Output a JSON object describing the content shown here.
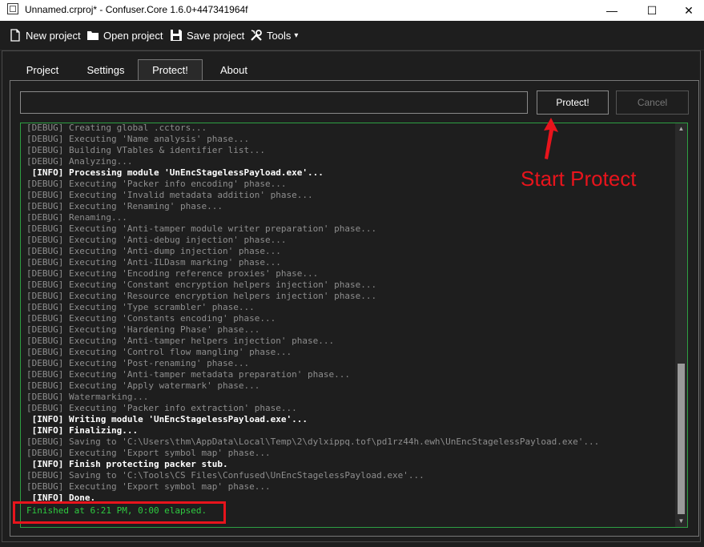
{
  "window": {
    "title": "Unnamed.crproj* - Confuser.Core 1.6.0+447341964f",
    "minimize": "—",
    "maximize": "☐",
    "close": "✕"
  },
  "toolbar": {
    "new_project": "New project",
    "open_project": "Open project",
    "save_project": "Save project",
    "tools": "Tools",
    "tools_caret": "▾"
  },
  "tabs": [
    "Project",
    "Settings",
    "Protect!",
    "About"
  ],
  "active_tab": "Protect!",
  "protect": {
    "path_value": "",
    "protect_label": "Protect!",
    "cancel_label": "Cancel"
  },
  "log": [
    {
      "level": "debug",
      "text": "[DEBUG] Creating global .cctors..."
    },
    {
      "level": "debug",
      "text": "[DEBUG] Executing 'Name analysis' phase..."
    },
    {
      "level": "debug",
      "text": "[DEBUG] Building VTables & identifier list..."
    },
    {
      "level": "debug",
      "text": "[DEBUG] Analyzing..."
    },
    {
      "level": "info",
      "text": " [INFO] Processing module 'UnEncStagelessPayload.exe'..."
    },
    {
      "level": "debug",
      "text": "[DEBUG] Executing 'Packer info encoding' phase..."
    },
    {
      "level": "debug",
      "text": "[DEBUG] Executing 'Invalid metadata addition' phase..."
    },
    {
      "level": "debug",
      "text": "[DEBUG] Executing 'Renaming' phase..."
    },
    {
      "level": "debug",
      "text": "[DEBUG] Renaming..."
    },
    {
      "level": "debug",
      "text": "[DEBUG] Executing 'Anti-tamper module writer preparation' phase..."
    },
    {
      "level": "debug",
      "text": "[DEBUG] Executing 'Anti-debug injection' phase..."
    },
    {
      "level": "debug",
      "text": "[DEBUG] Executing 'Anti-dump injection' phase..."
    },
    {
      "level": "debug",
      "text": "[DEBUG] Executing 'Anti-ILDasm marking' phase..."
    },
    {
      "level": "debug",
      "text": "[DEBUG] Executing 'Encoding reference proxies' phase..."
    },
    {
      "level": "debug",
      "text": "[DEBUG] Executing 'Constant encryption helpers injection' phase..."
    },
    {
      "level": "debug",
      "text": "[DEBUG] Executing 'Resource encryption helpers injection' phase..."
    },
    {
      "level": "debug",
      "text": "[DEBUG] Executing 'Type scrambler' phase..."
    },
    {
      "level": "debug",
      "text": "[DEBUG] Executing 'Constants encoding' phase..."
    },
    {
      "level": "debug",
      "text": "[DEBUG] Executing 'Hardening Phase' phase..."
    },
    {
      "level": "debug",
      "text": "[DEBUG] Executing 'Anti-tamper helpers injection' phase..."
    },
    {
      "level": "debug",
      "text": "[DEBUG] Executing 'Control flow mangling' phase..."
    },
    {
      "level": "debug",
      "text": "[DEBUG] Executing 'Post-renaming' phase..."
    },
    {
      "level": "debug",
      "text": "[DEBUG] Executing 'Anti-tamper metadata preparation' phase..."
    },
    {
      "level": "debug",
      "text": "[DEBUG] Executing 'Apply watermark' phase..."
    },
    {
      "level": "debug",
      "text": "[DEBUG] Watermarking..."
    },
    {
      "level": "debug",
      "text": "[DEBUG] Executing 'Packer info extraction' phase..."
    },
    {
      "level": "info",
      "text": " [INFO] Writing module 'UnEncStagelessPayload.exe'..."
    },
    {
      "level": "info",
      "text": " [INFO] Finalizing..."
    },
    {
      "level": "debug",
      "text": "[DEBUG] Saving to 'C:\\Users\\thm\\AppData\\Local\\Temp\\2\\dylxippq.tof\\pd1rz44h.ewh\\UnEncStagelessPayload.exe'..."
    },
    {
      "level": "debug",
      "text": "[DEBUG] Executing 'Export symbol map' phase..."
    },
    {
      "level": "info",
      "text": " [INFO] Finish protecting packer stub."
    },
    {
      "level": "debug",
      "text": "[DEBUG] Saving to 'C:\\Tools\\CS Files\\Confused\\UnEncStagelessPayload.exe'..."
    },
    {
      "level": "debug",
      "text": "[DEBUG] Executing 'Export symbol map' phase..."
    },
    {
      "level": "info",
      "text": " [INFO] Done."
    },
    {
      "level": "done",
      "text": "Finished at 6:21 PM, 0:00 elapsed."
    }
  ],
  "scroll": {
    "up": "▲",
    "down": "▼"
  },
  "annotation": {
    "label": "Start Protect",
    "color": "#e8141c"
  },
  "colors": {
    "background": "#1e1e1e",
    "log_border": "#2ea043",
    "debug_text": "#8e8e8e",
    "done_text": "#2ecc40"
  }
}
